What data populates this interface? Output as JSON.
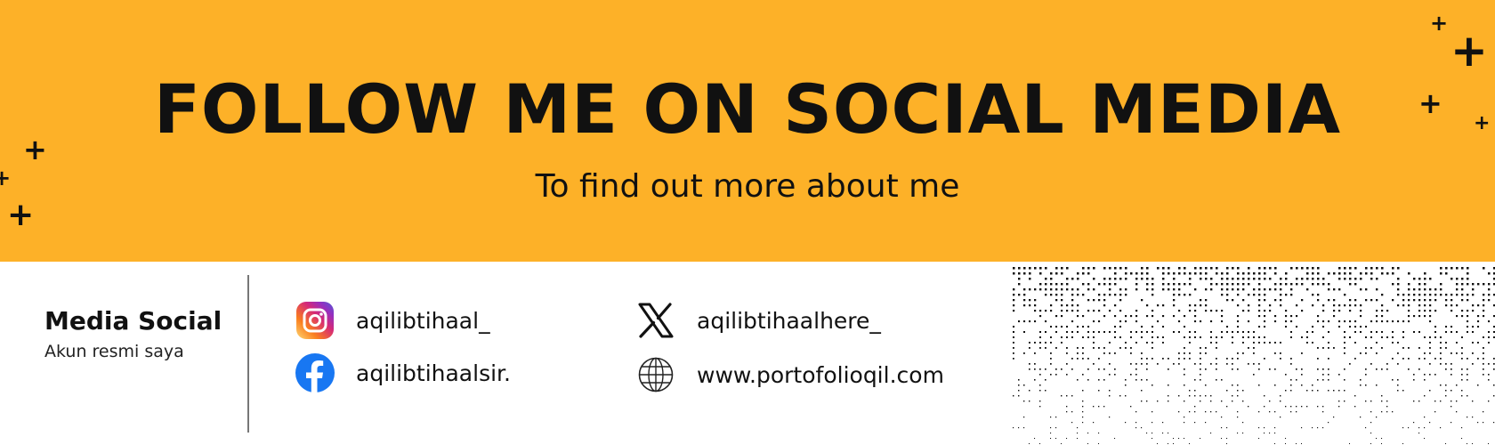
{
  "banner": {
    "headline": "FOLLOW ME ON SOCIAL MEDIA",
    "subline": "To find out more about me",
    "background_color": "#FDB128"
  },
  "card": {
    "title": "Media Social",
    "subtitle": "Akun resmi saya"
  },
  "socials": [
    {
      "icon": "instagram-icon",
      "handle": "aqilibtihaal_"
    },
    {
      "icon": "facebook-icon",
      "handle": "aqilibtihaalsir."
    },
    {
      "icon": "x-twitter-icon",
      "handle": "aqilibtihaalhere_"
    },
    {
      "icon": "globe-icon",
      "handle": "www.portofolioqil.com"
    }
  ],
  "colors": {
    "facebook": "#1877F2",
    "text": "#111111"
  }
}
